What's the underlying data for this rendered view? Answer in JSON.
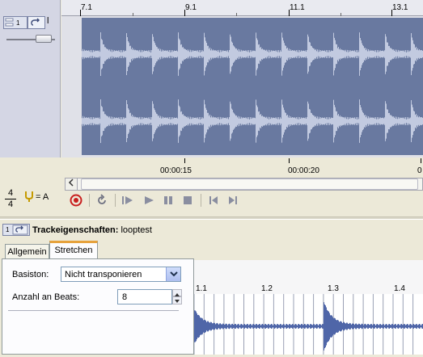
{
  "track": {
    "number": "1",
    "name_cut": "l"
  },
  "ruler": {
    "labels": [
      "7.1",
      "9.1",
      "11.1",
      "13.1"
    ]
  },
  "time_ruler": {
    "labels": [
      "00:00:15",
      "00:00:20",
      "0"
    ]
  },
  "meter": {
    "numerator": "4",
    "denominator": "4",
    "key": "= A"
  },
  "transport": {
    "record": "record-icon",
    "loop": "loop-icon",
    "play_from_start": "play-from-start-icon",
    "play": "play-icon",
    "pause": "pause-icon",
    "stop": "stop-icon",
    "prev": "previous-marker-icon",
    "next": "next-marker-icon"
  },
  "properties": {
    "track_number": "1",
    "title": "Trackeigenschaften:",
    "track_name": "looptest",
    "tabs": [
      "Allgemein",
      "Stretchen"
    ],
    "active_tab": "Stretchen",
    "basiston_label": "Basiston:",
    "basiston_value": "Nicht transponieren",
    "beats_label": "Anzahl an Beats:",
    "beats_value": "8"
  },
  "mini_ruler": {
    "labels": [
      "1.1",
      "1.2",
      "1.3",
      "1.4"
    ]
  },
  "colors": {
    "waveform_bg": "#6979a0",
    "waveform_fg": "#d2d9ec",
    "mini_wave": "#4f66a8",
    "active_tab_accent": "#e6a23c",
    "record": "#c81e1e"
  }
}
